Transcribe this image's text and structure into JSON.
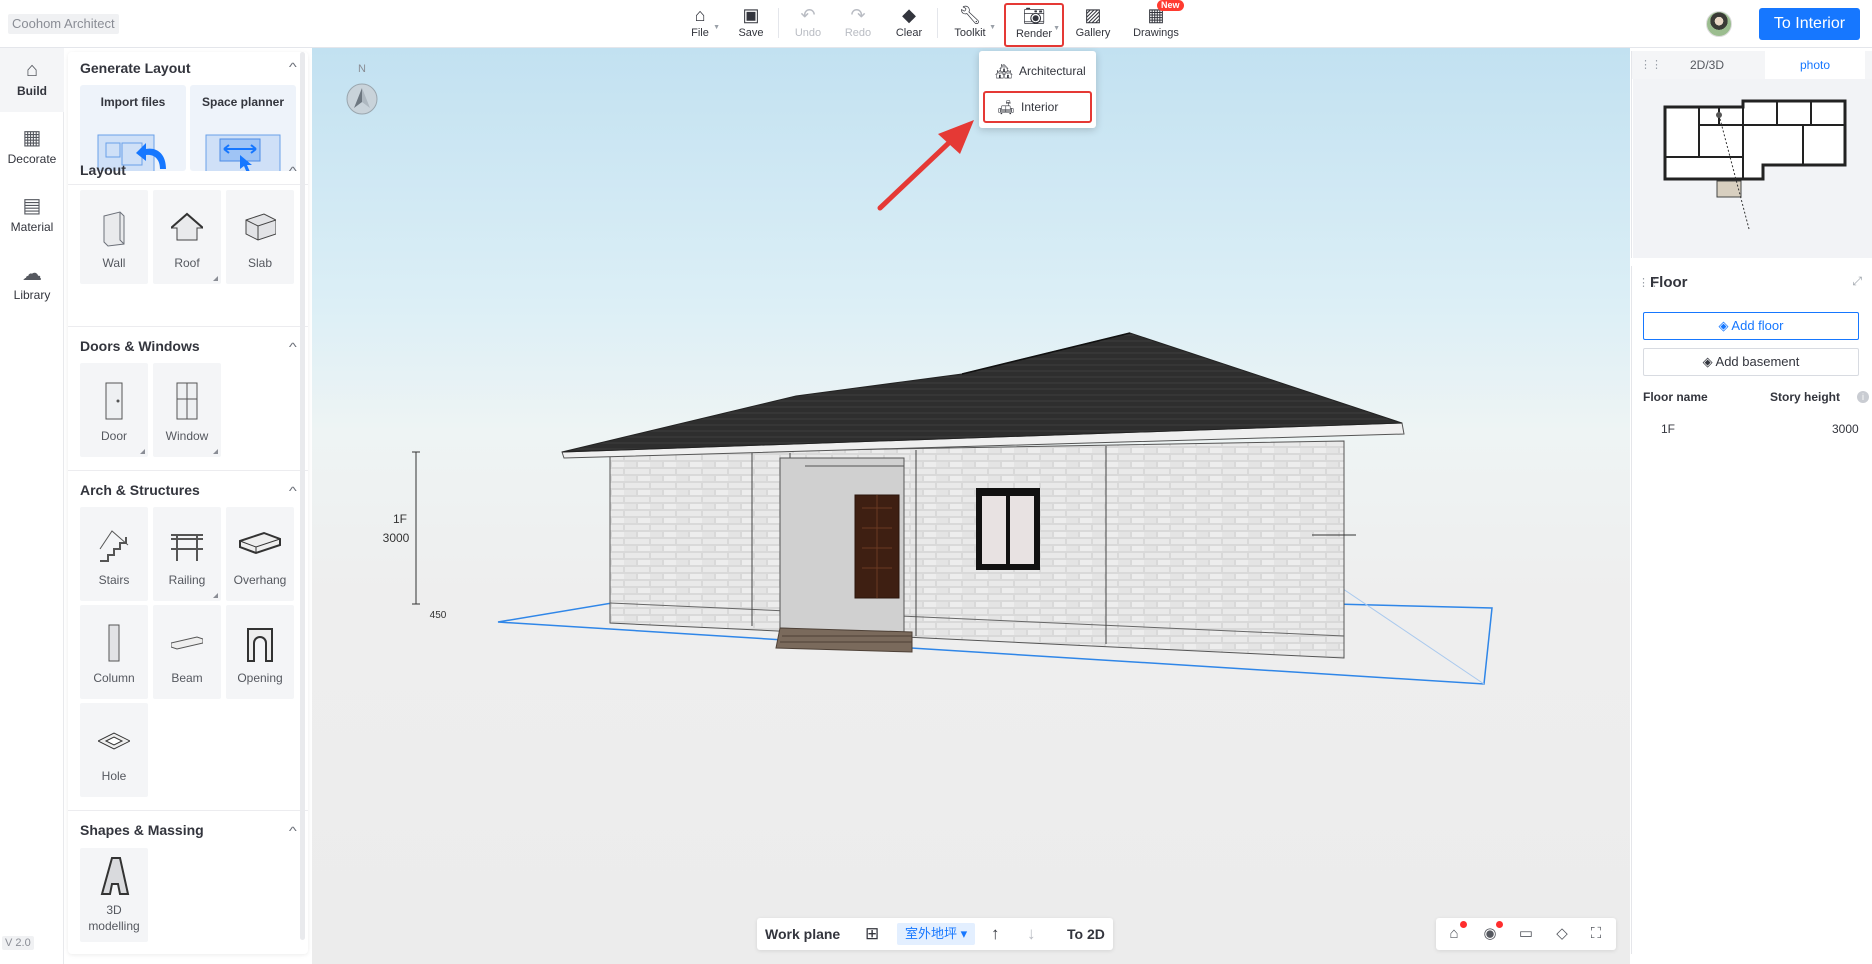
{
  "app": {
    "title": "Coohom Architect",
    "version": "V 2.0"
  },
  "toolbar": {
    "file": "File",
    "save": "Save",
    "undo": "Undo",
    "redo": "Redo",
    "clear": "Clear",
    "toolkit": "Toolkit",
    "render": "Render",
    "gallery": "Gallery",
    "drawings": "Drawings",
    "new_badge": "New",
    "to_interior": "To Interior"
  },
  "render_menu": {
    "items": [
      "Architectural",
      "Interior"
    ]
  },
  "left_nav": [
    {
      "label": "Build",
      "icon": "house-icon"
    },
    {
      "label": "Decorate",
      "icon": "decorate-icon"
    },
    {
      "label": "Material",
      "icon": "material-icon"
    },
    {
      "label": "Library",
      "icon": "library-icon"
    }
  ],
  "panel": {
    "generate_layout": {
      "title": "Generate Layout",
      "items": [
        "Import files",
        "Space planner"
      ]
    },
    "layout": {
      "title": "Layout",
      "items": [
        "Wall",
        "Roof",
        "Slab"
      ]
    },
    "doors_windows": {
      "title": "Doors & Windows",
      "items": [
        "Door",
        "Window"
      ]
    },
    "arch_structures": {
      "title": "Arch & Structures",
      "items": [
        "Stairs",
        "Railing",
        "Overhang",
        "Column",
        "Beam",
        "Opening",
        "Hole"
      ]
    },
    "shapes_massing": {
      "title": "Shapes & Massing",
      "items": [
        "3D modelling"
      ]
    }
  },
  "canvas": {
    "compass_label": "N",
    "dimension_floor": "1F",
    "dimension_height": "3000",
    "dimension_base": "450"
  },
  "work_bar": {
    "label": "Work plane",
    "level": "室外地坪",
    "to2d": "To 2D"
  },
  "minimap": {
    "tabs": [
      "2D/3D",
      "photo"
    ],
    "active_tab": "photo"
  },
  "floor_panel": {
    "title": "Floor",
    "add_floor": "Add floor",
    "add_basement": "Add basement",
    "col_name": "Floor name",
    "col_height": "Story height",
    "rows": [
      {
        "name": "1F",
        "height": "3000"
      }
    ]
  },
  "colors": {
    "accent": "#1677ff",
    "highlight": "#e53935",
    "roof": "#2b2b2b",
    "door": "#4a2616"
  }
}
